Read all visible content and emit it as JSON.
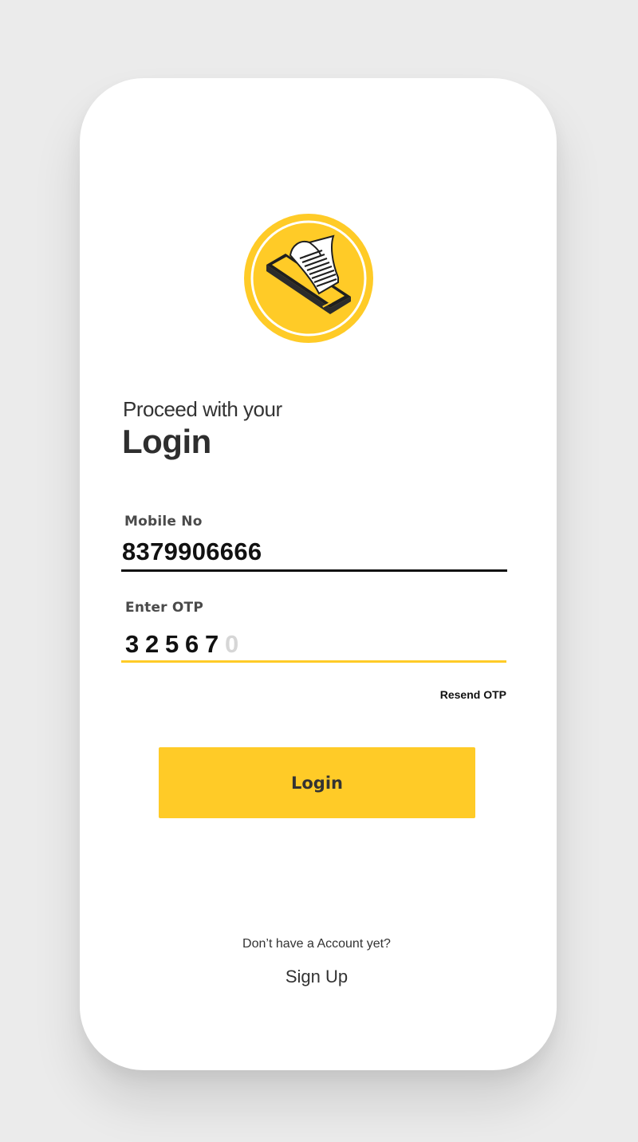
{
  "login": {
    "subtitle": "Proceed with your",
    "title": "Login"
  },
  "mobile": {
    "label": "Mobile No",
    "value": "8379906666"
  },
  "otp": {
    "label": "Enter OTP",
    "digits": [
      "3",
      "2",
      "5",
      "6",
      "7"
    ],
    "placeholder_digit": "0"
  },
  "resend": {
    "label": "Resend OTP"
  },
  "login_button": {
    "label": "Login"
  },
  "signup": {
    "prompt": "Don’t have a Account yet?",
    "link": "Sign Up"
  },
  "colors": {
    "accent": "#ffcb27",
    "background": "#ebebeb",
    "card": "#ffffff",
    "text": "#333333"
  },
  "icons": {
    "logo": "phone-receipt-icon"
  }
}
